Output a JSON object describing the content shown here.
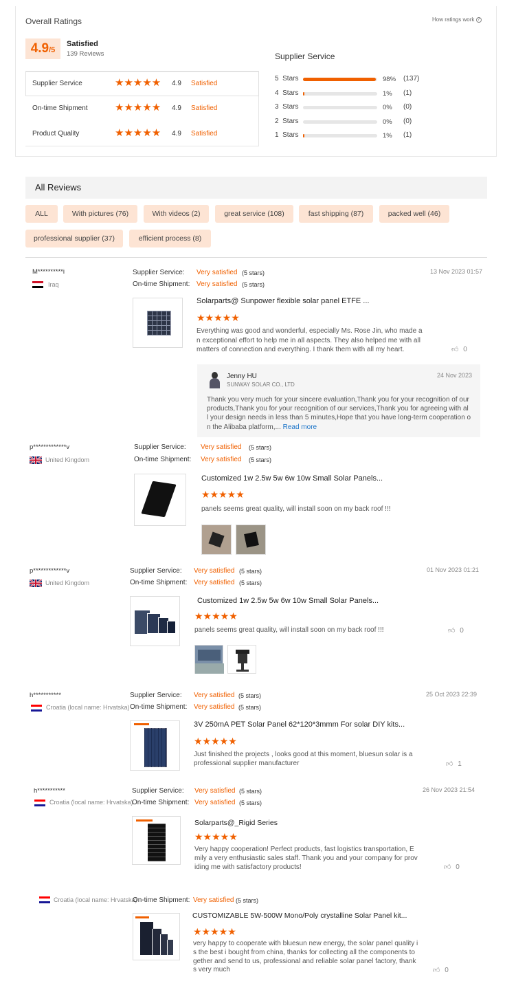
{
  "overall": {
    "title": "Overall Ratings",
    "how_link": "How ratings work",
    "score": "4.9",
    "score_max": "/5",
    "label": "Satisfied",
    "reviews_count": "139 Reviews",
    "rows": [
      {
        "name": "Supplier Service",
        "score": "4.9",
        "label": "Satisfied"
      },
      {
        "name": "On-time Shipment",
        "score": "4.9",
        "label": "Satisfied"
      },
      {
        "name": "Product Quality",
        "score": "4.9",
        "label": "Satisfied"
      }
    ]
  },
  "breakdown": {
    "title": "Supplier Service",
    "rows": [
      {
        "label": "5  Stars",
        "fraction": 0.98,
        "pct": "98%",
        "count": "(137)"
      },
      {
        "label": "4  Stars",
        "fraction": 0.01,
        "pct": "1%",
        "count": "(1)"
      },
      {
        "label": "3  Stars",
        "fraction": 0,
        "pct": "0%",
        "count": "(0)"
      },
      {
        "label": "2  Stars",
        "fraction": 0,
        "pct": "0%",
        "count": "(0)"
      },
      {
        "label": "1  Stars",
        "fraction": 0.01,
        "pct": "1%",
        "count": "(1)"
      }
    ]
  },
  "all_reviews": {
    "title": "All Reviews",
    "filters": [
      "ALL",
      "With pictures (76)",
      "With videos (2)",
      "great service (108)",
      "fast shipping (87)",
      "packed well (46)",
      "professional supplier (37)",
      "efficient process (8)"
    ]
  },
  "labels": {
    "supplier_service": "Supplier Service:",
    "ontime_shipment": "On-time Shipment:",
    "very_satisfied": "Very satisfied",
    "five_stars": "(5 stars)",
    "read_more": "Read more"
  },
  "reviews": [
    {
      "user": "M**********i",
      "country": "Iraq",
      "date": "13 Nov 2023 01:57",
      "product": "Solarparts@ Sunpower flexible solar panel ETFE ...",
      "text_lines": [
        "Everything was good and wonderful, especially Ms. Rose Jin, who made a",
        "n exceptional effort to help me in all aspects. They also helped me with all",
        "matters of connection and everything. I thank them with all my heart."
      ],
      "likes": "0",
      "reply": {
        "name": "Jenny HU",
        "company": "SUNWAY SOLAR CO., LTD",
        "date": "24 Nov 2023",
        "lines": [
          "Thank you very much for your sincere evaluation,Thank you for your recognition of our",
          "products,Thank you for your recognition of our services,Thank you for agreeing with al",
          "l your design needs in less than 5 minutes,Hope that you have long-term cooperation o",
          "n the Alibaba platform,..."
        ]
      }
    },
    {
      "user": "p*************v",
      "country": "United Kingdom",
      "product": "Customized 1w 2.5w 5w 6w 10w Small Solar Panels...",
      "text_lines": [
        "panels seems great quality, will install soon on my back roof !!!"
      ]
    },
    {
      "user": "p*************v",
      "country": "United Kingdom",
      "date": "01 Nov 2023 01:21",
      "product": "Customized 1w 2.5w 5w 6w 10w Small Solar Panels...",
      "text_lines": [
        "panels seems great quality, will install soon on my back roof !!!"
      ],
      "likes": "0"
    },
    {
      "user": "h***********",
      "country": "Croatia (local name: Hrvatska)",
      "date": "25 Oct 2023 22:39",
      "product": "3V 250mA PET Solar Panel 62*120*3mmm For solar DIY kits...",
      "text_lines": [
        "Just finished the projects , looks good at this moment, bluesun solar is a",
        "professional supplier manufacturer"
      ],
      "likes": "1"
    },
    {
      "user": "h***********",
      "country": "Croatia (local name: Hrvatska)",
      "date": "26 Nov 2023 21:54",
      "product": "Solarparts@_Rigid Series",
      "text_lines": [
        "Very happy cooperation! Perfect products, fast logistics transportation, E",
        "mily a very enthusiastic sales staff. Thank you and your company for prov",
        "iding me with satisfactory products!"
      ],
      "likes": "0"
    },
    {
      "country": "Croatia (local name: Hrvatska)",
      "product": "CUSTOMIZABLE 5W-500W Mono/Poly crystalline Solar Panel kit...",
      "text_lines": [
        "very happy to cooperate with bluesun new energy, the solar panel quality i",
        "s the best i bought from china, thanks for collecting all the components to",
        "gether and send to us, professional and reliable solar panel factory, thank",
        "s very much"
      ],
      "likes": "0"
    }
  ]
}
